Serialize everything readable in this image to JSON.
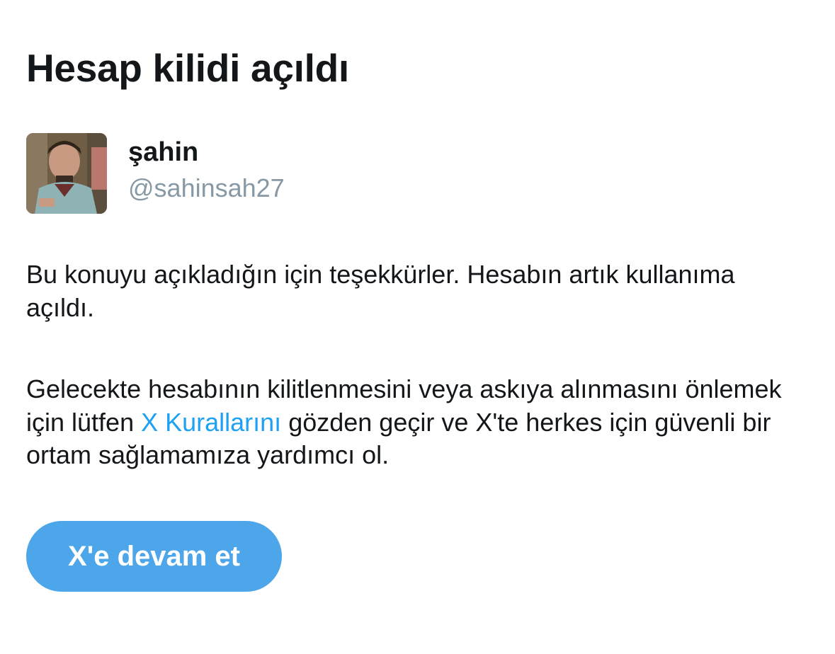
{
  "page": {
    "title": "Hesap kilidi açıldı"
  },
  "user": {
    "display_name": "şahin",
    "handle": "@sahinsah27",
    "avatar_icon": "profile-photo"
  },
  "message": {
    "paragraph1": "Bu konuyu açıkladığın için teşekkürler. Hesabın artık kullanıma açıldı.",
    "paragraph2_before": "Gelecekte hesabının kilitlenmesini veya askıya alınmasını önlemek için lütfen ",
    "paragraph2_link": "X Kurallarını",
    "paragraph2_after": " gözden geçir ve X'te herkes için güvenli bir ortam sağlamamıza yardımcı ol."
  },
  "actions": {
    "continue_label": "X'e devam et"
  },
  "colors": {
    "link": "#1da1f2",
    "button": "#4da6ea",
    "handle": "#8899a6",
    "text": "#14171a"
  }
}
